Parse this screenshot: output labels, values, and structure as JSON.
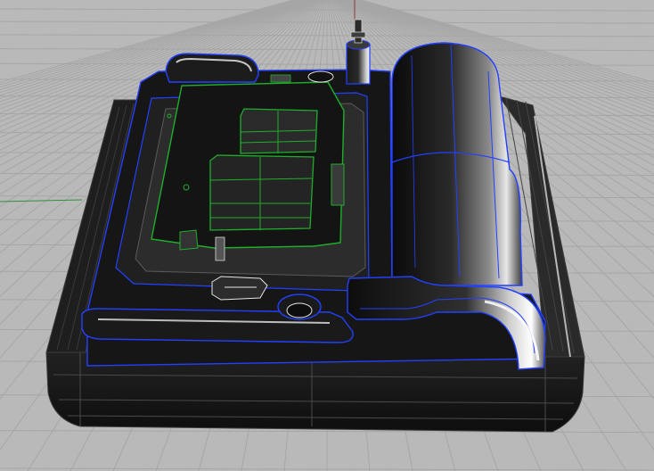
{
  "viewport": {
    "name": "Perspective",
    "background": "#b9b9b9",
    "grid_color": "#a6a6a6",
    "axis_x_color": "#8a3b3b",
    "axis_y_color": "#2f8f3f"
  },
  "model": {
    "body_color": "#1a1a1a",
    "edge_color": "#2340ff",
    "pcb_outline_color": "#1fae2a",
    "highlight_color": "#f2f2f2"
  }
}
